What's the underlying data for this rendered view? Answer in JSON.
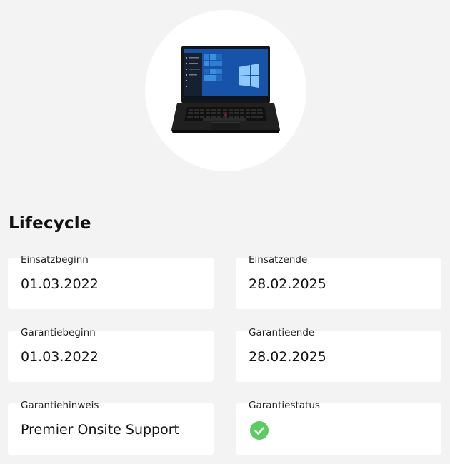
{
  "device": {
    "image": "laptop-icon"
  },
  "section": {
    "title": "Lifecycle"
  },
  "fields": [
    {
      "label": "Einsatzbeginn",
      "value": "01.03.2022"
    },
    {
      "label": "Einsatzende",
      "value": "28.02.2025"
    },
    {
      "label": "Garantiebeginn",
      "value": "01.03.2022"
    },
    {
      "label": "Garantieende",
      "value": "28.02.2025"
    },
    {
      "label": "Garantiehinweis",
      "value": "Premier Onsite Support"
    },
    {
      "label": "Garantiestatus",
      "status_icon": "check-circle-icon"
    }
  ],
  "colors": {
    "background": "#f3f3f3",
    "card": "#ffffff",
    "status_ok": "#5ccb61"
  }
}
